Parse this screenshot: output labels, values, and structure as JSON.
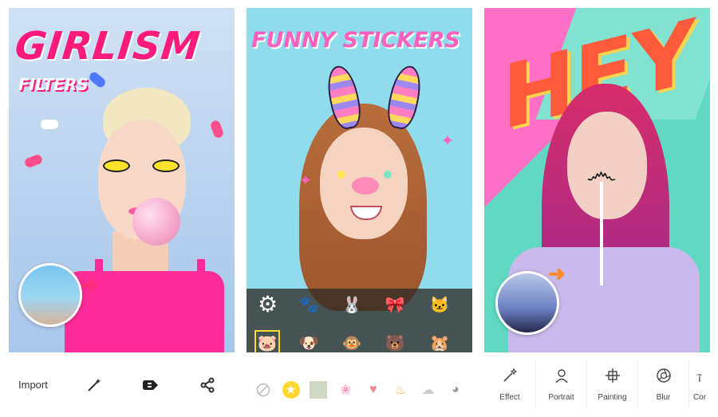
{
  "panels": {
    "girlism": {
      "headline": "GIRLISM",
      "subheadline": "FILTERS",
      "toolbar": {
        "import_label": "Import",
        "icons": [
          "magic-wand-icon",
          "eraser-icon",
          "share-icon"
        ]
      }
    },
    "stickers": {
      "headline": "FUNNY STICKERS",
      "tray_icons": [
        "gear-icon",
        "sticker-icons"
      ],
      "category_icons": [
        "none-icon",
        "star-icon",
        "sticker-category-icons"
      ]
    },
    "hey": {
      "headline": "HEY",
      "tools": [
        {
          "label": "Effect",
          "icon": "magic-wand-icon"
        },
        {
          "label": "Portrait",
          "icon": "person-icon"
        },
        {
          "label": "Painting",
          "icon": "painting-icon"
        },
        {
          "label": "Blur",
          "icon": "aperture-icon"
        },
        {
          "label": "Cor",
          "icon": "text-icon"
        }
      ]
    }
  },
  "colors": {
    "girlism_headline": "#ff1a7c",
    "stickers_headline": "#ff5fbd",
    "hey_headline": "#ff5a3c",
    "sticker_selected": "#ffd92f"
  }
}
